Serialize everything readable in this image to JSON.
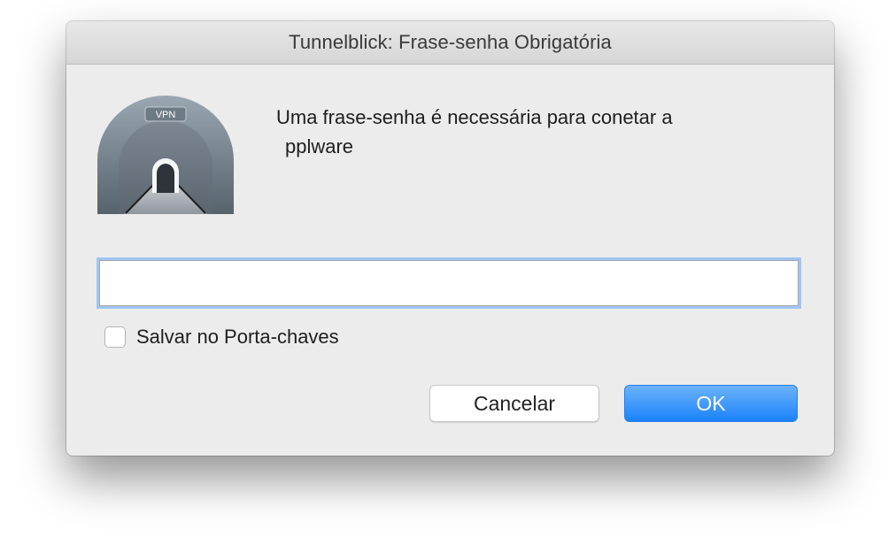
{
  "window": {
    "title": "Tunnelblick: Frase-senha Obrigatória"
  },
  "icon": {
    "name": "tunnelblick-vpn-tunnel-icon",
    "badge": "VPN"
  },
  "message": {
    "line1": "Uma frase-senha é necessária para conetar a",
    "line2": "pplware"
  },
  "passphrase": {
    "value": "",
    "placeholder": ""
  },
  "remember": {
    "label": "Salvar no Porta-chaves",
    "checked": false
  },
  "buttons": {
    "cancel": "Cancelar",
    "ok": "OK"
  },
  "colors": {
    "accent": "#1a82fb",
    "focus_ring": "#9ec5f3",
    "dialog_bg": "#ececec"
  }
}
